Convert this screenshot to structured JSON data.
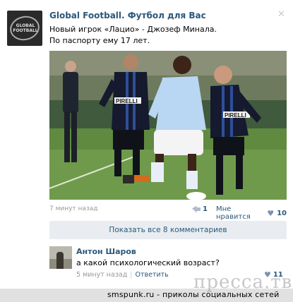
{
  "post": {
    "author": "Global Football. Футбол для Вас",
    "avatar_text": "GLOBAL FOOTBALL",
    "text_line1": "Новый игрок «Лацио» - Джозеф Минала.",
    "text_line2": "По паспорту ему 17 лет.",
    "time": "7 минут назад",
    "share_count": "1",
    "like_label": "Мне нравится",
    "like_count": "10",
    "photo": {
      "description": "football match photo",
      "left_shirt_logo": "PIRELLI",
      "right_shirt_logo": "PIRELLI"
    }
  },
  "comments": {
    "show_all_label": "Показать все 8 комментариев",
    "items": [
      {
        "author": "Антон Шаров",
        "text": "а какой психологический возраст?",
        "time": "5 минут назад",
        "reply_label": "Ответить",
        "like_count": "11"
      }
    ]
  },
  "footer": {
    "text": "smspunk.ru - приколы социальных сетей",
    "watermark": "пресса.тв"
  },
  "colors": {
    "link": "#2b587a",
    "muted": "#999999",
    "button_bg": "#e9edf1"
  },
  "icons": [
    "close-icon",
    "share-icon",
    "heart-icon"
  ]
}
